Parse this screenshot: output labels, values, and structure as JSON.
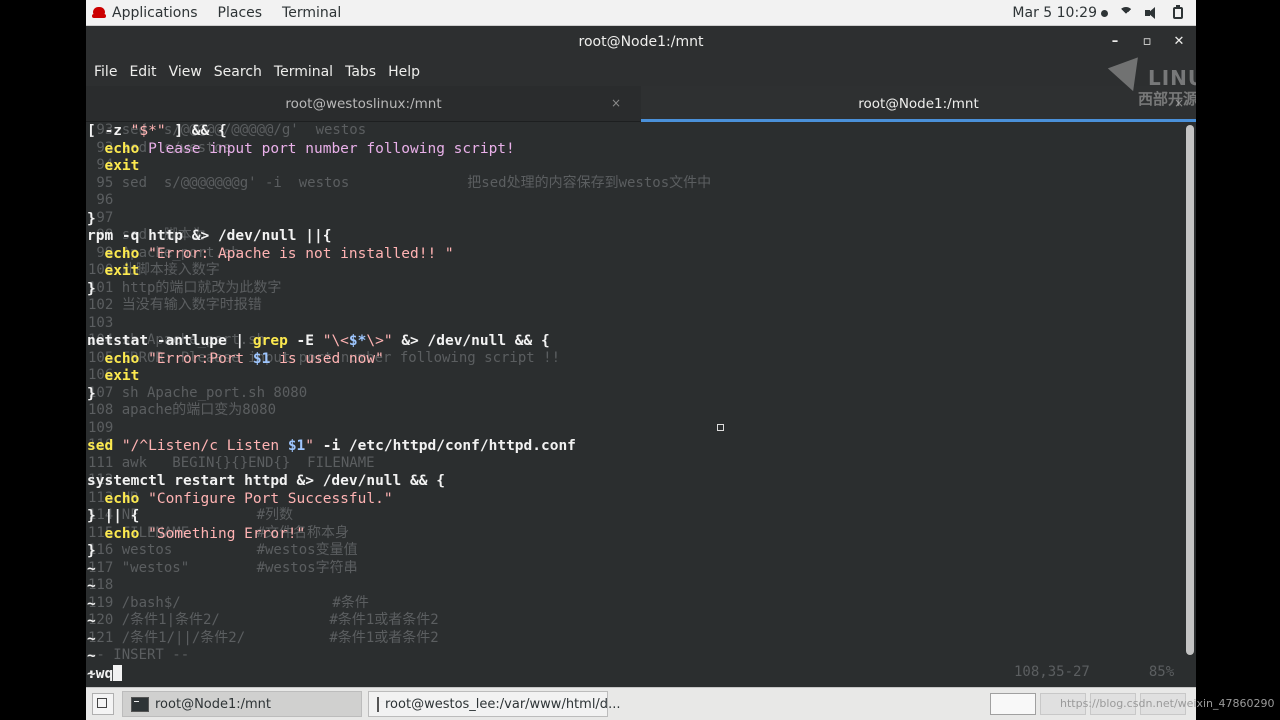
{
  "topbar": {
    "applications": "Applications",
    "places": "Places",
    "terminal": "Terminal",
    "clock": "Mar 5  10:29"
  },
  "window": {
    "title": "root@Node1:/mnt",
    "minimize": "–",
    "maximize": "▫",
    "close": "✕"
  },
  "menubar": [
    "File",
    "Edit",
    "View",
    "Search",
    "Terminal",
    "Tabs",
    "Help"
  ],
  "tabs": [
    {
      "label": "root@westoslinux:/mnt",
      "close": "×"
    },
    {
      "label": "root@Node1:/mnt",
      "close": "×"
    }
  ],
  "logo": {
    "word": "LINUX",
    "sub": "西部开源"
  },
  "editor": {
    "lines": [
      [
        [
          "plain",
          "[ "
        ],
        [
          "plain",
          "-z "
        ],
        [
          "str",
          "\"$*\""
        ],
        [
          "plain",
          " ] && {"
        ]
      ],
      [
        [
          "plain",
          "  "
        ],
        [
          "kw",
          "echo"
        ],
        [
          "str2",
          " Please input port number following script!"
        ]
      ],
      [
        [
          "plain",
          "  "
        ],
        [
          "kw",
          "exit"
        ]
      ],
      [
        [
          "plain",
          ""
        ]
      ],
      [
        [
          "plain",
          ""
        ]
      ],
      [
        [
          "plain",
          "}"
        ]
      ],
      [
        [
          "plain",
          "rpm -q http &> /dev/null ||{"
        ]
      ],
      [
        [
          "plain",
          "  "
        ],
        [
          "kw",
          "echo"
        ],
        [
          "str",
          " \"Error: Apache is not installed!! \""
        ]
      ],
      [
        [
          "plain",
          "  "
        ],
        [
          "kw",
          "exit"
        ]
      ],
      [
        [
          "plain",
          "}"
        ]
      ],
      [
        [
          "plain",
          ""
        ]
      ],
      [
        [
          "plain",
          ""
        ]
      ],
      [
        [
          "plain",
          "netstat -antlupe | "
        ],
        [
          "kw",
          "grep"
        ],
        [
          "plain",
          " -E "
        ],
        [
          "str",
          "\"\\<"
        ],
        [
          "var",
          "$*"
        ],
        [
          "str",
          "\\>\""
        ],
        [
          "plain",
          " &> /dev/null && {"
        ]
      ],
      [
        [
          "plain",
          "  "
        ],
        [
          "kw",
          "echo"
        ],
        [
          "str",
          " \"Error:Port "
        ],
        [
          "var",
          "$1"
        ],
        [
          "str",
          " is used now\""
        ]
      ],
      [
        [
          "plain",
          "  "
        ],
        [
          "kw",
          "exit"
        ]
      ],
      [
        [
          "plain",
          "}"
        ]
      ],
      [
        [
          "plain",
          ""
        ]
      ],
      [
        [
          "plain",
          ""
        ]
      ],
      [
        [
          "kw",
          "sed"
        ],
        [
          "str",
          " \"/^Listen/c Listen "
        ],
        [
          "var",
          "$1"
        ],
        [
          "str",
          "\""
        ],
        [
          "plain",
          " -i /etc/httpd/conf/httpd.conf"
        ]
      ],
      [
        [
          "plain",
          ""
        ]
      ],
      [
        [
          "plain",
          "systemctl restart httpd &> /dev/null && {"
        ]
      ],
      [
        [
          "plain",
          "  "
        ],
        [
          "kw",
          "echo"
        ],
        [
          "str",
          " \"Configure Port Successful.\""
        ]
      ],
      [
        [
          "plain",
          "} || {"
        ]
      ],
      [
        [
          "plain",
          "  "
        ],
        [
          "kw",
          "echo"
        ],
        [
          "str",
          " \"Something Error!\""
        ]
      ],
      [
        [
          "plain",
          "}"
        ]
      ],
      [
        [
          "plain",
          "~"
        ]
      ],
      [
        [
          "plain",
          "~"
        ]
      ],
      [
        [
          "plain",
          "~"
        ]
      ],
      [
        [
          "plain",
          "~"
        ]
      ],
      [
        [
          "plain",
          "~"
        ]
      ],
      [
        [
          "plain",
          "~"
        ]
      ],
      [
        [
          "plain",
          "~"
        ]
      ]
    ],
    "command": ":wq",
    "ghost_lines": [
      " 93 sed  s/@@@@@/@@@@@/g'  westos",
      " 93 sed  s/westos",
      " 94",
      " 95 sed  s/@@@@@@@g' -i  westos              把sed处理的内容保存到westos文件中",
      " 96",
      " 97",
      " 98 sed  脚本为",
      " 99 Apache_port.sh",
      "100 此脚本接入数字",
      "101 http的端口就改为此数字",
      "102 当没有输入数字时报错",
      "103",
      "104 sh Apache_port.sh",
      "105 ERROR: Pleaase input port number following script !!",
      "106",
      "107 sh Apache_port.sh 8080",
      "108 apache的端口变为8080",
      "109",
      "110",
      "111 awk   BEGIN{}{}END{}  FILENAME",
      "112",
      "113 NR",
      "114 NF              #列数",
      "115 FILENAME        #文件名称本身",
      "116 westos          #westos变量值",
      "117 \"westos\"        #westos字符串",
      "118",
      "119 /bash$/                  #条件",
      "120 /条件1|条件2/             #条件1或者条件2",
      "121 /条件1/||/条件2/          #条件1或者条件2",
      "-- INSERT --"
    ],
    "status": "108,35-27       85%"
  },
  "taskbar": {
    "tasks": [
      {
        "label": "root@Node1:/mnt"
      },
      {
        "label": "root@westos_lee:/var/www/html/d..."
      }
    ]
  },
  "credit": "https://blog.csdn.net/weixin_47860290"
}
